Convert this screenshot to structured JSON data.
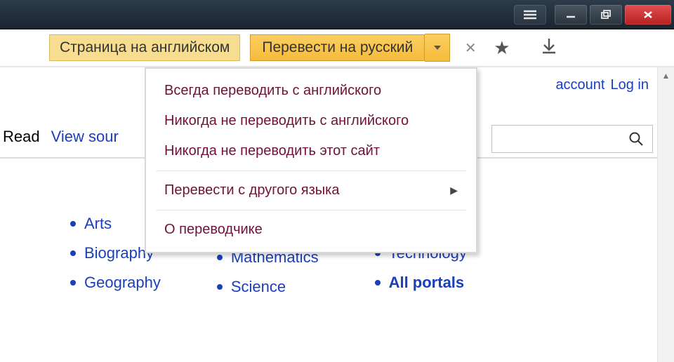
{
  "translate_bar": {
    "page_lang_label": "Страница на английском",
    "translate_button": "Перевести на русский"
  },
  "dropdown": {
    "items": [
      "Всегда переводить с английского",
      "Никогда не переводить с английского",
      "Никогда не переводить этот сайт"
    ],
    "other_lang": "Перевести с другого языка",
    "about": "О переводчике"
  },
  "top_links": {
    "account": "account",
    "login": "Log in"
  },
  "tabs": {
    "read": "Read",
    "view_source": "View sour"
  },
  "portal_links": {
    "col1": [
      "Arts",
      "Biography",
      "Geography"
    ],
    "col2": [
      "Mathematics",
      "Science"
    ],
    "col3": [
      "Technology",
      "All portals"
    ],
    "col3_visible_letter": "y"
  }
}
